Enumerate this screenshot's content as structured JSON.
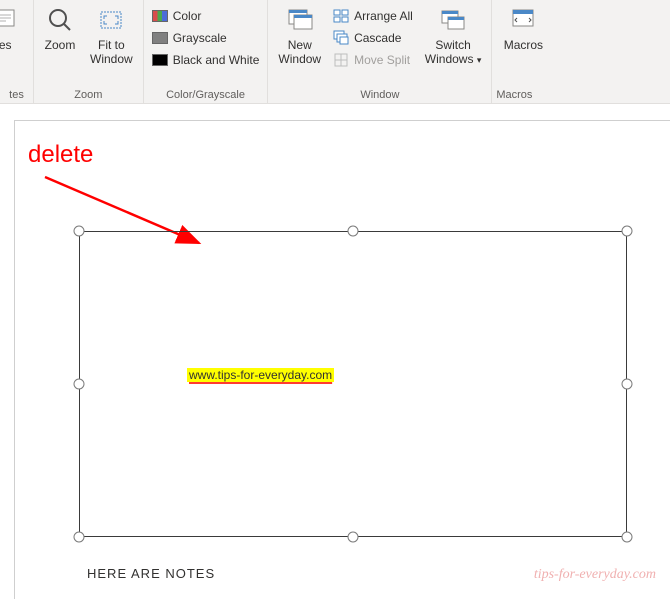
{
  "ribbon": {
    "groups": {
      "notes_left": {
        "label": "tes",
        "notes_btn": "tes"
      },
      "zoom": {
        "label": "Zoom",
        "zoom_btn": "Zoom",
        "fit_btn": "Fit to\nWindow"
      },
      "color": {
        "label": "Color/Grayscale",
        "color_btn": "Color",
        "gray_btn": "Grayscale",
        "bw_btn": "Black and White"
      },
      "window": {
        "label": "Window",
        "new_btn": "New\nWindow",
        "arrange_btn": "Arrange All",
        "cascade_btn": "Cascade",
        "move_btn": "Move Split",
        "switch_btn": "Switch\nWindows"
      },
      "macros": {
        "label": "Macros",
        "macros_btn": "Macros"
      }
    }
  },
  "annotation": {
    "label": "delete"
  },
  "slide": {
    "text": "www.tips-for-everyday.com"
  },
  "notes": {
    "text": "HERE ARE NOTES"
  },
  "watermark": {
    "text": "tips-for-everyday.com"
  }
}
